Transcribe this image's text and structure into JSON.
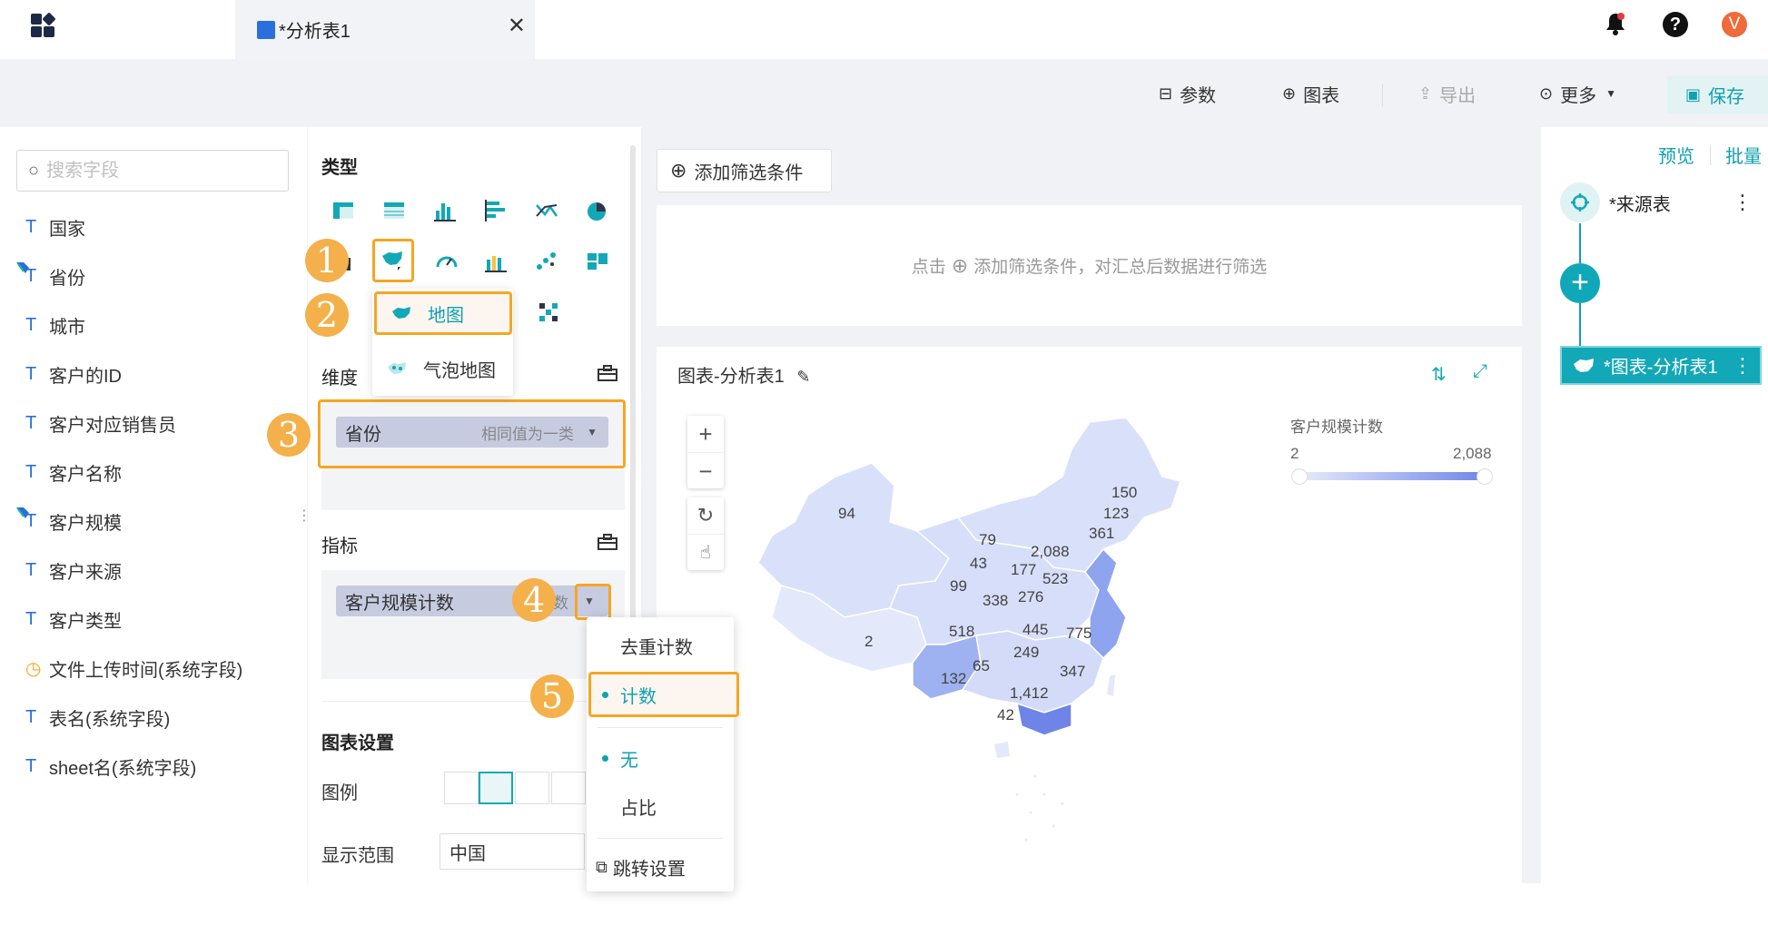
{
  "tab": {
    "title": "*分析表1"
  },
  "toolbar": {
    "params": "参数",
    "chart": "图表",
    "export": "导出",
    "more": "更多",
    "save": "保存"
  },
  "header": {
    "avatar_initial": "V",
    "help": "?"
  },
  "search": {
    "placeholder": "搜索字段"
  },
  "fields": [
    {
      "label": "国家",
      "type": "T"
    },
    {
      "label": "省份",
      "type": "T"
    },
    {
      "label": "城市",
      "type": "T"
    },
    {
      "label": "客户的ID",
      "type": "T"
    },
    {
      "label": "客户对应销售员",
      "type": "T"
    },
    {
      "label": "客户名称",
      "type": "T"
    },
    {
      "label": "客户规模",
      "type": "T"
    },
    {
      "label": "客户来源",
      "type": "T"
    },
    {
      "label": "客户类型",
      "type": "T"
    },
    {
      "label": "文件上传时间(系统字段)",
      "type": "time"
    },
    {
      "label": "表名(系统字段)",
      "type": "T"
    },
    {
      "label": "sheet名(系统字段)",
      "type": "T"
    }
  ],
  "config": {
    "type_title": "类型",
    "dimension_title": "维度",
    "metric_title": "指标",
    "chart_settings_title": "图表设置",
    "legend_label": "图例",
    "range_label": "显示范围",
    "range_value": "中国",
    "dimension_pill": {
      "label": "省份",
      "hint": "相同值为一类"
    },
    "metric_pill": {
      "label": "客户规模计数",
      "hint": "数"
    }
  },
  "map_menu": {
    "items": [
      "地图",
      "气泡地图"
    ]
  },
  "badges": [
    "1",
    "2",
    "3",
    "4",
    "5"
  ],
  "agg_menu": {
    "items": [
      "去重计数",
      "计数",
      "无",
      "占比",
      "跳转设置"
    ]
  },
  "filter": {
    "button": "添加筛选条件",
    "hint_prefix": "点击",
    "hint_suffix": "添加筛选条件，对汇总后数据进行筛选"
  },
  "chart_card": {
    "title": "图表-分析表1",
    "legend_title": "客户规模计数",
    "legend_min": "2",
    "legend_max": "2,088",
    "labels": [
      "94",
      "150",
      "123",
      "361",
      "79",
      "2,088",
      "43",
      "177",
      "523",
      "99",
      "338",
      "276",
      "2",
      "518",
      "445",
      "775",
      "249",
      "65",
      "132",
      "347",
      "1,412",
      "42"
    ]
  },
  "right_panel": {
    "preview": "预览",
    "batch": "批量",
    "source_node": "*来源表",
    "chart_node": "*图表-分析表1"
  },
  "colors": {
    "accent": "#10a0b0",
    "highlight": "#f5a623",
    "map_fill": "#d9e1fa"
  }
}
